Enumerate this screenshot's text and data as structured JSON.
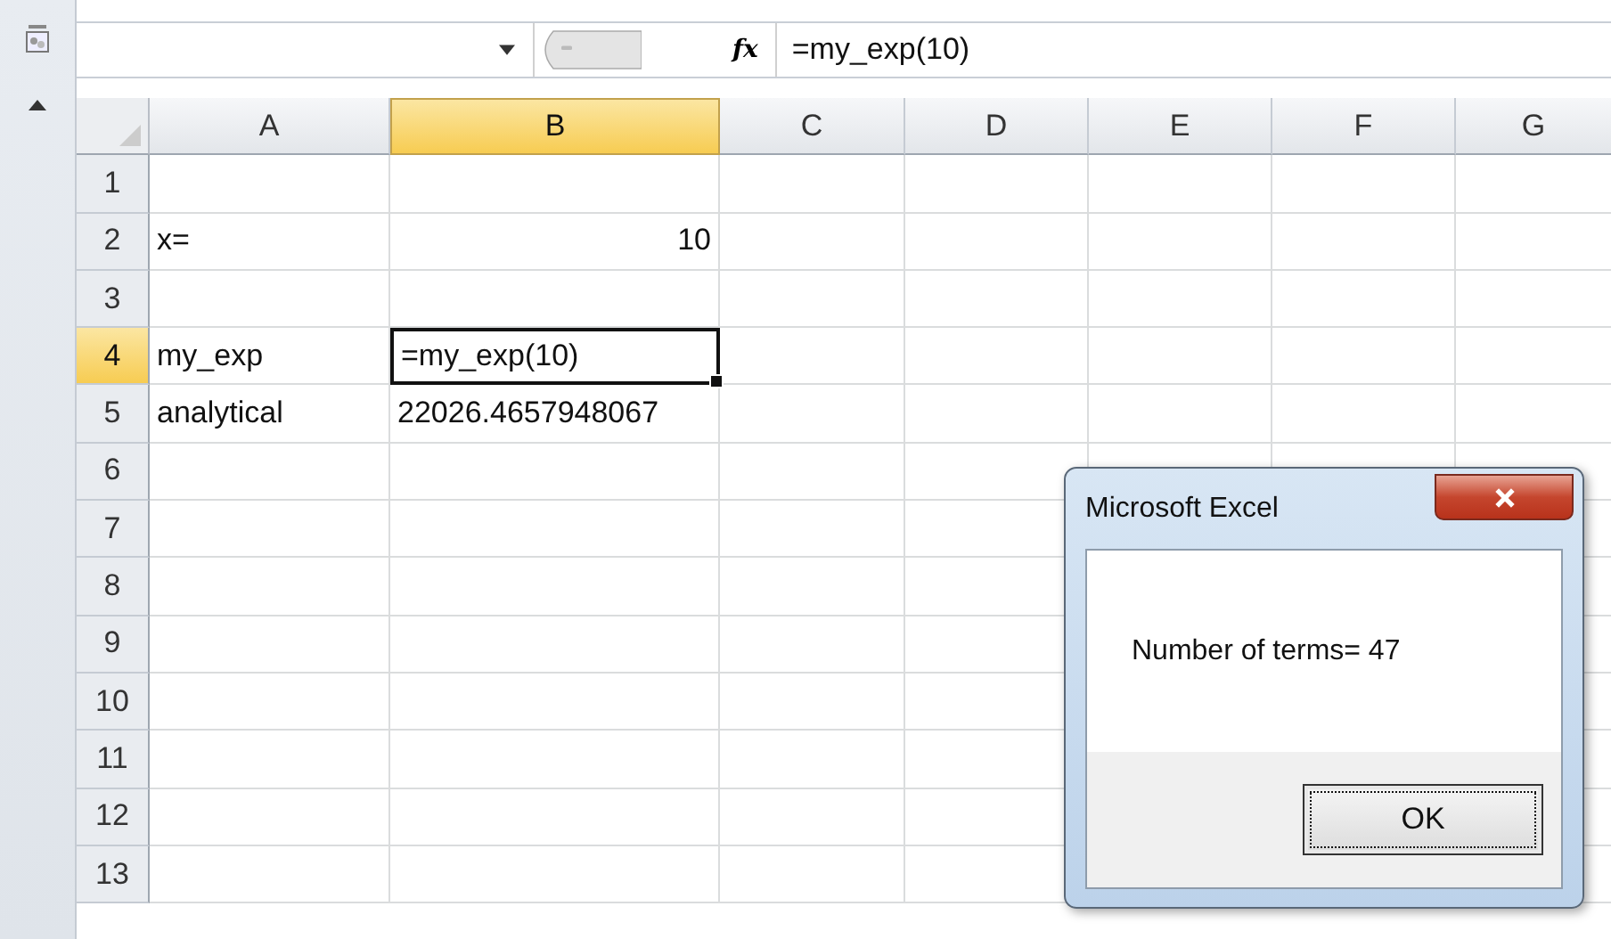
{
  "formula_bar": {
    "formula": {
      "value": "=my_exp(10)"
    },
    "fx_label": "fx"
  },
  "sheet": {
    "columns": [
      {
        "label": "A",
        "selected": false
      },
      {
        "label": "B",
        "selected": true
      },
      {
        "label": "C",
        "selected": false
      },
      {
        "label": "D",
        "selected": false
      },
      {
        "label": "E",
        "selected": false
      },
      {
        "label": "F",
        "selected": false
      },
      {
        "label": "G",
        "selected": false
      }
    ],
    "rows": [
      {
        "label": "1",
        "selected": false
      },
      {
        "label": "2",
        "selected": false,
        "cells": {
          "a": {
            "text": "x=",
            "kind": "text",
            "selected": false
          },
          "b": {
            "text": "10",
            "kind": "number",
            "selected": false
          }
        }
      },
      {
        "label": "3",
        "selected": false
      },
      {
        "label": "4",
        "selected": true,
        "cells": {
          "a": {
            "text": "my_exp",
            "kind": "text",
            "selected": false
          },
          "b": {
            "text": "=my_exp(10)",
            "kind": "text",
            "selected": true
          }
        }
      },
      {
        "label": "5",
        "selected": false,
        "cells": {
          "a": {
            "text": "analytical",
            "kind": "text",
            "selected": false
          },
          "b": {
            "text": "22026.4657948067",
            "kind": "text",
            "selected": false
          }
        }
      },
      {
        "label": "6",
        "selected": false
      },
      {
        "label": "7",
        "selected": false
      },
      {
        "label": "8",
        "selected": false
      },
      {
        "label": "9",
        "selected": false
      },
      {
        "label": "10",
        "selected": false
      },
      {
        "label": "11",
        "selected": false
      },
      {
        "label": "12",
        "selected": false
      },
      {
        "label": "13",
        "selected": false
      }
    ]
  },
  "dialog": {
    "title": "Microsoft Excel",
    "message": "Number of terms= 47",
    "buttons": [
      {
        "label": "OK",
        "focused": true
      }
    ]
  }
}
